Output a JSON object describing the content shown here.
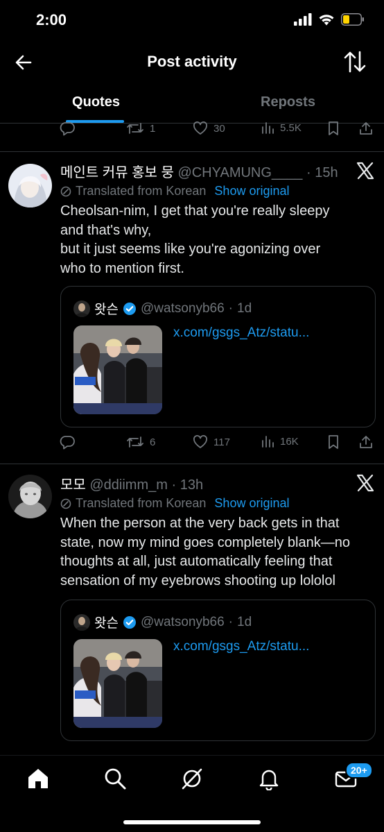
{
  "status": {
    "time": "2:00"
  },
  "header": {
    "title": "Post activity"
  },
  "tabs": [
    {
      "label": "Quotes"
    },
    {
      "label": "Reposts"
    }
  ],
  "top_stats": {
    "replies": "",
    "reposts": "1",
    "likes": "30",
    "views": "5.5K"
  },
  "posts": [
    {
      "name": "메인트 커뮤 홍보 뭉",
      "handle": "@CHYAMUNG____",
      "time": "15h",
      "translated_label": "Translated from Korean",
      "show_original": "Show original",
      "text_lines": [
        "Cheolsan-nim, I get that you're really sleepy",
        "and that's why,",
        "but it just seems like you're agonizing over",
        "who to mention first."
      ],
      "quote": {
        "name": "왓슨",
        "handle": "@watsonyb66",
        "time": "1d",
        "link": "x.com/gsgs_Atz/statu..."
      },
      "stats": {
        "reposts": "6",
        "likes": "117",
        "views": "16K"
      }
    },
    {
      "name": "모모",
      "handle": "@ddiimm_m",
      "time": "13h",
      "translated_label": "Translated from Korean",
      "show_original": "Show original",
      "text_lines": [
        "When the person at the very back gets in that",
        "state, now my mind goes completely blank—no",
        "thoughts at all, just automatically feeling that",
        "sensation of my eyebrows shooting up lololol"
      ],
      "quote": {
        "name": "왓슨",
        "handle": "@watsonyb66",
        "time": "1d",
        "link": "x.com/gsgs_Atz/statu..."
      }
    }
  ],
  "nav": {
    "badge": "20+"
  },
  "colors": {
    "accent": "#1d9bf0",
    "muted": "#71767b",
    "background": "#000000",
    "battery": "#ffd400"
  }
}
